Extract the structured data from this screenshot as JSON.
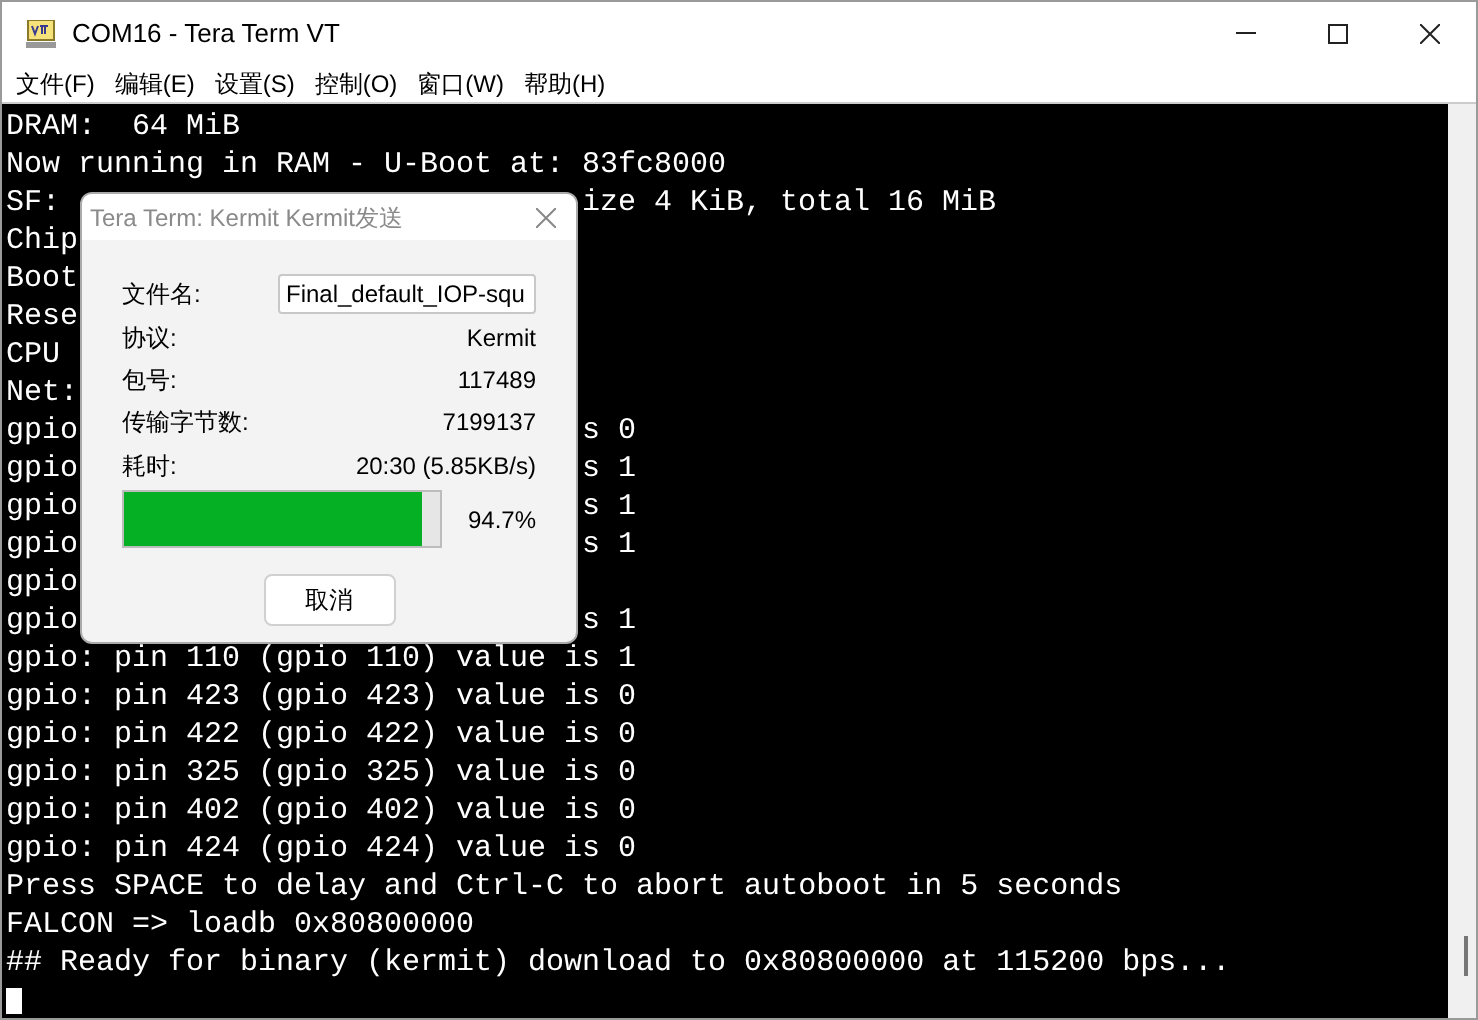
{
  "window": {
    "title": "COM16 - Tera Term VT"
  },
  "menu": [
    "文件(F)",
    "编辑(E)",
    "设置(S)",
    "控制(O)",
    "窗口(W)",
    "帮助(H)"
  ],
  "terminal": {
    "lines": [
      {
        "text": "DRAM:  64 MiB"
      },
      {
        "text": "Now running in RAM - U-Boot at: 83fc8000"
      },
      {
        "text": "SF: ",
        "after_dialog": "ize 4 KiB, total 16 MiB"
      },
      {
        "text": "Chip"
      },
      {
        "text": "Boot"
      },
      {
        "text": "Rese"
      },
      {
        "text": "CPU"
      },
      {
        "text": "Net:"
      },
      {
        "text": "gpio",
        "after_dialog": "s 0"
      },
      {
        "text": "gpio",
        "after_dialog": "s 1"
      },
      {
        "text": "gpio",
        "after_dialog": "s 1"
      },
      {
        "text": "gpio",
        "after_dialog": "s 1"
      },
      {
        "text": "gpio"
      },
      {
        "text": "gpio",
        "after_dialog": "s 1"
      },
      {
        "text": "gpio: pin 110 (gpio 110) value is 1"
      },
      {
        "text": "gpio: pin 423 (gpio 423) value is 0"
      },
      {
        "text": "gpio: pin 422 (gpio 422) value is 0"
      },
      {
        "text": "gpio: pin 325 (gpio 325) value is 0"
      },
      {
        "text": "gpio: pin 402 (gpio 402) value is 0"
      },
      {
        "text": "gpio: pin 424 (gpio 424) value is 0"
      },
      {
        "text": "Press SPACE to delay and Ctrl-C to abort autoboot in 5 seconds"
      },
      {
        "text": "FALCON => loadb 0x80800000"
      },
      {
        "text": "## Ready for binary (kermit) download to 0x80800000 at 115200 bps..."
      }
    ]
  },
  "dialog": {
    "title": "Tera Term: Kermit Kermit发送",
    "filename": {
      "label": "文件名:",
      "value": "Final_default_IOP-squ"
    },
    "fields": [
      {
        "label": "协议:",
        "value": "Kermit"
      },
      {
        "label": "包号:",
        "value": "117489"
      },
      {
        "label": "传输字节数:",
        "value": "7199137"
      },
      {
        "label": "耗时:",
        "value": "20:30 (5.85KB/s)"
      }
    ],
    "progress": {
      "level": 0.94,
      "reading": "94.7%"
    },
    "cancel_button": "取消"
  }
}
